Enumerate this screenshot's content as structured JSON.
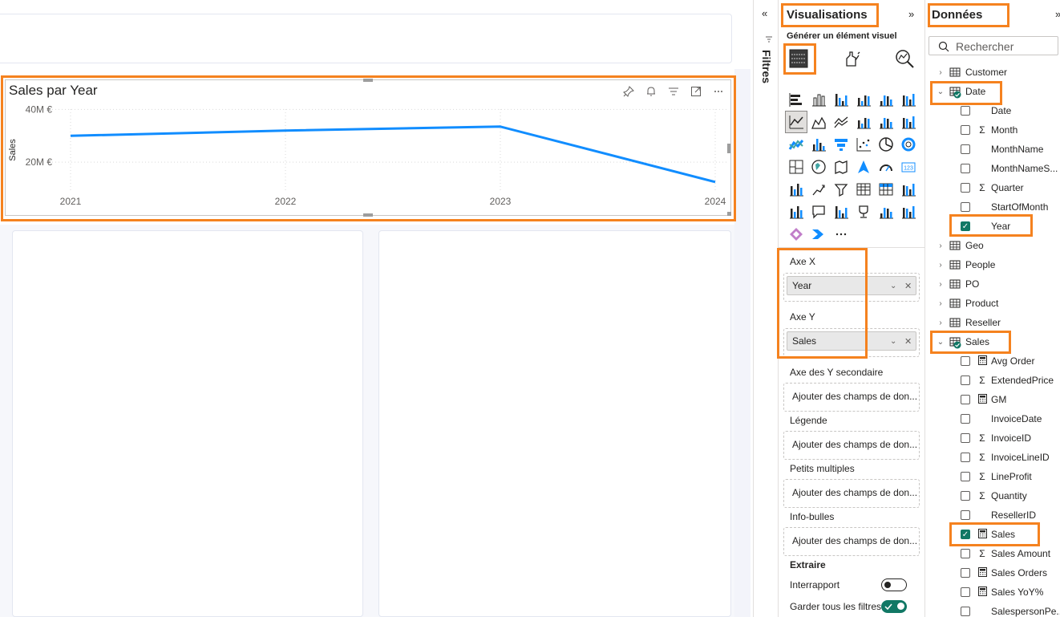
{
  "visual": {
    "title": "Sales par Year",
    "y_axis_title": "Sales",
    "y_ticks": [
      "40M €",
      "20M €"
    ],
    "toolbar_icons": [
      "pin-icon",
      "bell-icon",
      "filter-icon",
      "focus-mode-icon",
      "more-options-icon"
    ]
  },
  "chart_data": {
    "type": "line",
    "title": "Sales par Year",
    "xlabel": "",
    "ylabel": "Sales",
    "categories": [
      "2021",
      "2022",
      "2023",
      "2024"
    ],
    "series": [
      {
        "values": [
          30000000,
          32000000,
          33500000,
          12500000
        ]
      }
    ],
    "ylim": [
      10000000,
      45000000
    ],
    "y_ticks": [
      40000000,
      20000000
    ],
    "y_tick_labels": [
      "40M €",
      "20M €"
    ],
    "grid": true,
    "line_color": "#118dff"
  },
  "filters": {
    "label": "Filtres"
  },
  "visualisations": {
    "title": "Visualisations",
    "build_label": "Générer un élément visuel",
    "wells": {
      "x_axis": {
        "label": "Axe X",
        "field": "Year"
      },
      "y_axis": {
        "label": "Axe Y",
        "field": "Sales"
      },
      "secondary_y": {
        "label": "Axe des Y secondaire",
        "placeholder": "Ajouter des champs de don..."
      },
      "legend": {
        "label": "Légende",
        "placeholder": "Ajouter des champs de don..."
      },
      "small_multiples": {
        "label": "Petits multiples",
        "placeholder": "Ajouter des champs de don..."
      },
      "tooltips": {
        "label": "Info-bulles",
        "placeholder": "Ajouter des champs de don..."
      }
    },
    "drillthrough": {
      "label": "Extraire",
      "cross_report": {
        "label": "Interrapport",
        "on": false
      },
      "keep_filters": {
        "label": "Garder tous les filtres",
        "on": true
      }
    },
    "more_visuals": "···"
  },
  "data": {
    "title": "Données",
    "search_placeholder": "Rechercher",
    "tree": [
      {
        "kind": "table",
        "label": "Customer",
        "expanded": false,
        "active": false
      },
      {
        "kind": "table",
        "label": "Date",
        "expanded": true,
        "active": true
      },
      {
        "kind": "field",
        "label": "Date",
        "icon": "",
        "checked": false
      },
      {
        "kind": "field",
        "label": "Month",
        "icon": "Σ",
        "checked": false
      },
      {
        "kind": "field",
        "label": "MonthName",
        "icon": "",
        "checked": false
      },
      {
        "kind": "field",
        "label": "MonthNameS...",
        "icon": "",
        "checked": false
      },
      {
        "kind": "field",
        "label": "Quarter",
        "icon": "Σ",
        "checked": false
      },
      {
        "kind": "field",
        "label": "StartOfMonth",
        "icon": "",
        "checked": false
      },
      {
        "kind": "field",
        "label": "Year",
        "icon": "",
        "checked": true
      },
      {
        "kind": "table",
        "label": "Geo",
        "expanded": false,
        "active": false
      },
      {
        "kind": "table",
        "label": "People",
        "expanded": false,
        "active": false
      },
      {
        "kind": "table",
        "label": "PO",
        "expanded": false,
        "active": false
      },
      {
        "kind": "table",
        "label": "Product",
        "expanded": false,
        "active": false
      },
      {
        "kind": "table",
        "label": "Reseller",
        "expanded": false,
        "active": false
      },
      {
        "kind": "table",
        "label": "Sales",
        "expanded": true,
        "active": true
      },
      {
        "kind": "field",
        "label": "Avg Order",
        "icon": "calc",
        "checked": false
      },
      {
        "kind": "field",
        "label": "ExtendedPrice",
        "icon": "Σ",
        "checked": false
      },
      {
        "kind": "field",
        "label": "GM",
        "icon": "calc",
        "checked": false
      },
      {
        "kind": "field",
        "label": "InvoiceDate",
        "icon": "",
        "checked": false
      },
      {
        "kind": "field",
        "label": "InvoiceID",
        "icon": "Σ",
        "checked": false
      },
      {
        "kind": "field",
        "label": "InvoiceLineID",
        "icon": "Σ",
        "checked": false
      },
      {
        "kind": "field",
        "label": "LineProfit",
        "icon": "Σ",
        "checked": false
      },
      {
        "kind": "field",
        "label": "Quantity",
        "icon": "Σ",
        "checked": false
      },
      {
        "kind": "field",
        "label": "ResellerID",
        "icon": "",
        "checked": false
      },
      {
        "kind": "field",
        "label": "Sales",
        "icon": "calc",
        "checked": true
      },
      {
        "kind": "field",
        "label": "Sales Amount",
        "icon": "Σ",
        "checked": false
      },
      {
        "kind": "field",
        "label": "Sales Orders",
        "icon": "calc",
        "checked": false
      },
      {
        "kind": "field",
        "label": "Sales YoY%",
        "icon": "calc",
        "checked": false
      },
      {
        "kind": "field",
        "label": "SalespersonPe...",
        "icon": "",
        "checked": false
      }
    ]
  },
  "colors": {
    "accent": "#f5821f",
    "check": "#117865",
    "line": "#118dff"
  }
}
